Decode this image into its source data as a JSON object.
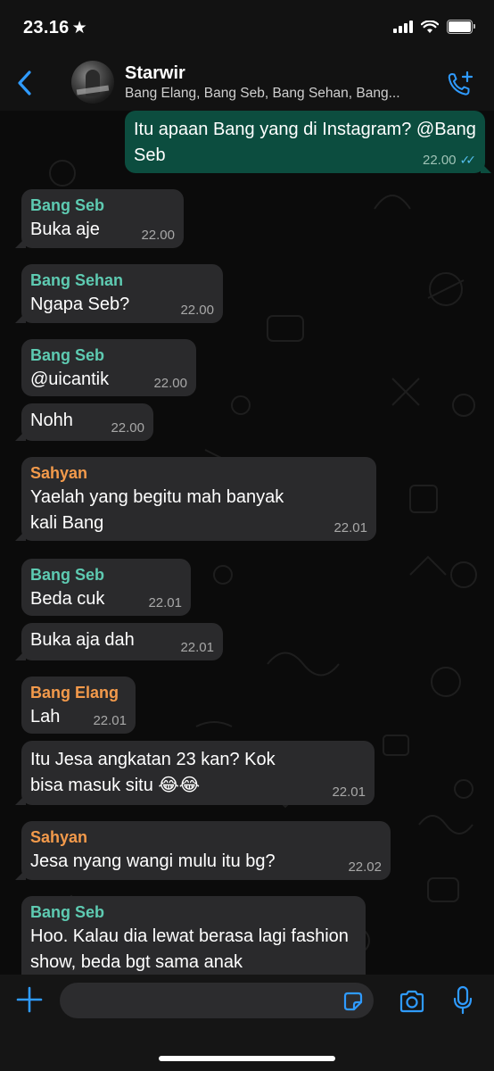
{
  "status_bar": {
    "time": "23.16",
    "star": "★"
  },
  "header": {
    "title": "Starwir",
    "subtitle": "Bang Elang, Bang Seb, Bang Sehan, Bang..."
  },
  "colors": {
    "accent": "#2f9bff",
    "outgoing_bubble": "#0c4d3f",
    "incoming_bubble": "#2a2a2c",
    "sender_green": "#5ecbb2",
    "sender_orange": "#f39a4b",
    "read_ticks": "#53bdeb"
  },
  "messages": [
    {
      "dir": "out",
      "sender": "",
      "text": "Itu apaan Bang yang di Instagram? @Bang Seb",
      "time": "22.00",
      "ticks": "✓✓"
    },
    {
      "dir": "in",
      "sender": "Bang Seb",
      "sender_color": "#5ecbb2",
      "text": "Buka aje",
      "time": "22.00"
    },
    {
      "dir": "in",
      "sender": "Bang Sehan",
      "sender_color": "#5ecbb2",
      "text": "Ngapa Seb?",
      "time": "22.00"
    },
    {
      "dir": "in",
      "sender": "Bang Seb",
      "sender_color": "#5ecbb2",
      "text": "@uicantik",
      "time": "22.00"
    },
    {
      "dir": "in",
      "sender": "",
      "text": "Nohh",
      "time": "22.00"
    },
    {
      "dir": "in",
      "sender": "Sahyan",
      "sender_color": "#f39a4b",
      "text": "Yaelah yang begitu mah banyak kali Bang",
      "time": "22.01"
    },
    {
      "dir": "in",
      "sender": "Bang Seb",
      "sender_color": "#5ecbb2",
      "text": "Beda cuk",
      "time": "22.01"
    },
    {
      "dir": "in",
      "sender": "",
      "text": "Buka aja dah",
      "time": "22.01"
    },
    {
      "dir": "in",
      "sender": "Bang Elang",
      "sender_color": "#f39a4b",
      "text": "Lah",
      "time": "22.01"
    },
    {
      "dir": "in",
      "sender": "",
      "text": "Itu Jesa angkatan 23 kan? Kok bisa masuk situ 😂😂",
      "time": "22.01"
    },
    {
      "dir": "in",
      "sender": "Sahyan",
      "sender_color": "#f39a4b",
      "text": "Jesa nyang wangi mulu itu bg?",
      "time": "22.02"
    },
    {
      "dir": "in",
      "sender": "Bang Seb",
      "sender_color": "#5ecbb2",
      "text": "Hoo. Kalau dia lewat berasa lagi fashion show, beda bgt sama anak",
      "time": ""
    }
  ],
  "composer": {
    "placeholder": ""
  },
  "icons": [
    "chevron-left-icon",
    "add-call-icon",
    "plus-icon",
    "sticker-icon",
    "camera-icon",
    "microphone-icon"
  ]
}
